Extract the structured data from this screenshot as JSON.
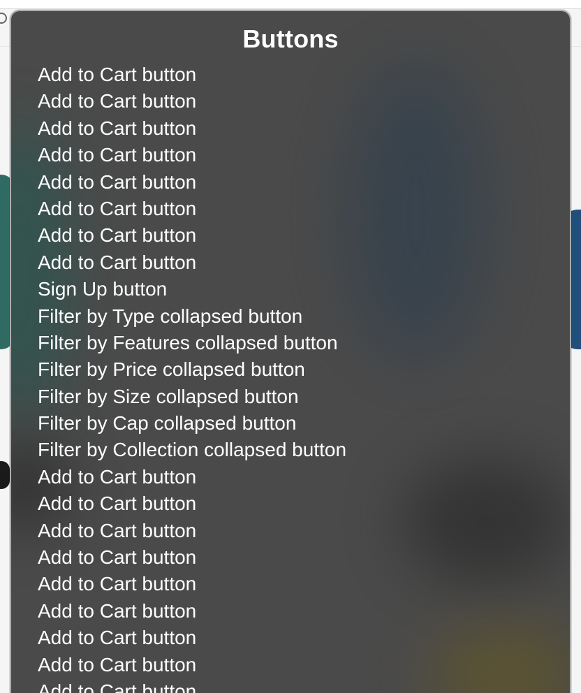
{
  "rotor": {
    "title": "Buttons",
    "items": [
      "Add to Cart button",
      "Add to Cart button",
      "Add to Cart button",
      "Add to Cart button",
      "Add to Cart button",
      "Add to Cart button",
      "Add to Cart button",
      "Add to Cart button",
      "Sign Up button",
      "Filter by Type collapsed button",
      "Filter by Features collapsed button",
      "Filter by Price collapsed button",
      "Filter by Size collapsed button",
      "Filter by Cap collapsed button",
      "Filter by Collection collapsed button",
      "Add to Cart button",
      "Add to Cart button",
      "Add to Cart button",
      "Add to Cart button",
      "Add to Cart button",
      "Add to Cart button",
      "Add to Cart button",
      "Add to Cart button",
      "Add to Cart button"
    ]
  },
  "colors": {
    "panel_background": "#4a4a4a",
    "text": "#ffffff"
  }
}
